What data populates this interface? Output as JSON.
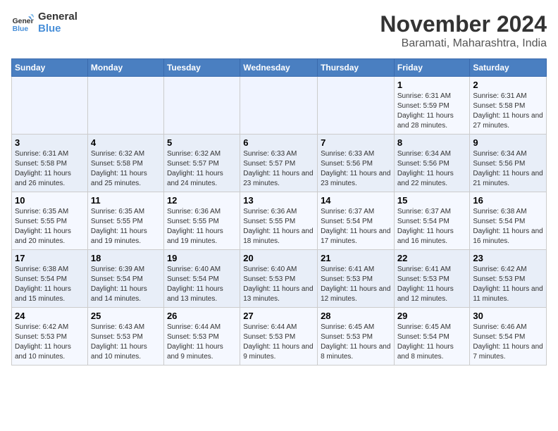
{
  "logo": {
    "line1": "General",
    "line2": "Blue"
  },
  "title": "November 2024",
  "location": "Baramati, Maharashtra, India",
  "headers": [
    "Sunday",
    "Monday",
    "Tuesday",
    "Wednesday",
    "Thursday",
    "Friday",
    "Saturday"
  ],
  "weeks": [
    [
      {
        "day": "",
        "info": ""
      },
      {
        "day": "",
        "info": ""
      },
      {
        "day": "",
        "info": ""
      },
      {
        "day": "",
        "info": ""
      },
      {
        "day": "",
        "info": ""
      },
      {
        "day": "1",
        "info": "Sunrise: 6:31 AM\nSunset: 5:59 PM\nDaylight: 11 hours and 28 minutes."
      },
      {
        "day": "2",
        "info": "Sunrise: 6:31 AM\nSunset: 5:58 PM\nDaylight: 11 hours and 27 minutes."
      }
    ],
    [
      {
        "day": "3",
        "info": "Sunrise: 6:31 AM\nSunset: 5:58 PM\nDaylight: 11 hours and 26 minutes."
      },
      {
        "day": "4",
        "info": "Sunrise: 6:32 AM\nSunset: 5:58 PM\nDaylight: 11 hours and 25 minutes."
      },
      {
        "day": "5",
        "info": "Sunrise: 6:32 AM\nSunset: 5:57 PM\nDaylight: 11 hours and 24 minutes."
      },
      {
        "day": "6",
        "info": "Sunrise: 6:33 AM\nSunset: 5:57 PM\nDaylight: 11 hours and 23 minutes."
      },
      {
        "day": "7",
        "info": "Sunrise: 6:33 AM\nSunset: 5:56 PM\nDaylight: 11 hours and 23 minutes."
      },
      {
        "day": "8",
        "info": "Sunrise: 6:34 AM\nSunset: 5:56 PM\nDaylight: 11 hours and 22 minutes."
      },
      {
        "day": "9",
        "info": "Sunrise: 6:34 AM\nSunset: 5:56 PM\nDaylight: 11 hours and 21 minutes."
      }
    ],
    [
      {
        "day": "10",
        "info": "Sunrise: 6:35 AM\nSunset: 5:55 PM\nDaylight: 11 hours and 20 minutes."
      },
      {
        "day": "11",
        "info": "Sunrise: 6:35 AM\nSunset: 5:55 PM\nDaylight: 11 hours and 19 minutes."
      },
      {
        "day": "12",
        "info": "Sunrise: 6:36 AM\nSunset: 5:55 PM\nDaylight: 11 hours and 19 minutes."
      },
      {
        "day": "13",
        "info": "Sunrise: 6:36 AM\nSunset: 5:55 PM\nDaylight: 11 hours and 18 minutes."
      },
      {
        "day": "14",
        "info": "Sunrise: 6:37 AM\nSunset: 5:54 PM\nDaylight: 11 hours and 17 minutes."
      },
      {
        "day": "15",
        "info": "Sunrise: 6:37 AM\nSunset: 5:54 PM\nDaylight: 11 hours and 16 minutes."
      },
      {
        "day": "16",
        "info": "Sunrise: 6:38 AM\nSunset: 5:54 PM\nDaylight: 11 hours and 16 minutes."
      }
    ],
    [
      {
        "day": "17",
        "info": "Sunrise: 6:38 AM\nSunset: 5:54 PM\nDaylight: 11 hours and 15 minutes."
      },
      {
        "day": "18",
        "info": "Sunrise: 6:39 AM\nSunset: 5:54 PM\nDaylight: 11 hours and 14 minutes."
      },
      {
        "day": "19",
        "info": "Sunrise: 6:40 AM\nSunset: 5:54 PM\nDaylight: 11 hours and 13 minutes."
      },
      {
        "day": "20",
        "info": "Sunrise: 6:40 AM\nSunset: 5:53 PM\nDaylight: 11 hours and 13 minutes."
      },
      {
        "day": "21",
        "info": "Sunrise: 6:41 AM\nSunset: 5:53 PM\nDaylight: 11 hours and 12 minutes."
      },
      {
        "day": "22",
        "info": "Sunrise: 6:41 AM\nSunset: 5:53 PM\nDaylight: 11 hours and 12 minutes."
      },
      {
        "day": "23",
        "info": "Sunrise: 6:42 AM\nSunset: 5:53 PM\nDaylight: 11 hours and 11 minutes."
      }
    ],
    [
      {
        "day": "24",
        "info": "Sunrise: 6:42 AM\nSunset: 5:53 PM\nDaylight: 11 hours and 10 minutes."
      },
      {
        "day": "25",
        "info": "Sunrise: 6:43 AM\nSunset: 5:53 PM\nDaylight: 11 hours and 10 minutes."
      },
      {
        "day": "26",
        "info": "Sunrise: 6:44 AM\nSunset: 5:53 PM\nDaylight: 11 hours and 9 minutes."
      },
      {
        "day": "27",
        "info": "Sunrise: 6:44 AM\nSunset: 5:53 PM\nDaylight: 11 hours and 9 minutes."
      },
      {
        "day": "28",
        "info": "Sunrise: 6:45 AM\nSunset: 5:53 PM\nDaylight: 11 hours and 8 minutes."
      },
      {
        "day": "29",
        "info": "Sunrise: 6:45 AM\nSunset: 5:54 PM\nDaylight: 11 hours and 8 minutes."
      },
      {
        "day": "30",
        "info": "Sunrise: 6:46 AM\nSunset: 5:54 PM\nDaylight: 11 hours and 7 minutes."
      }
    ]
  ]
}
